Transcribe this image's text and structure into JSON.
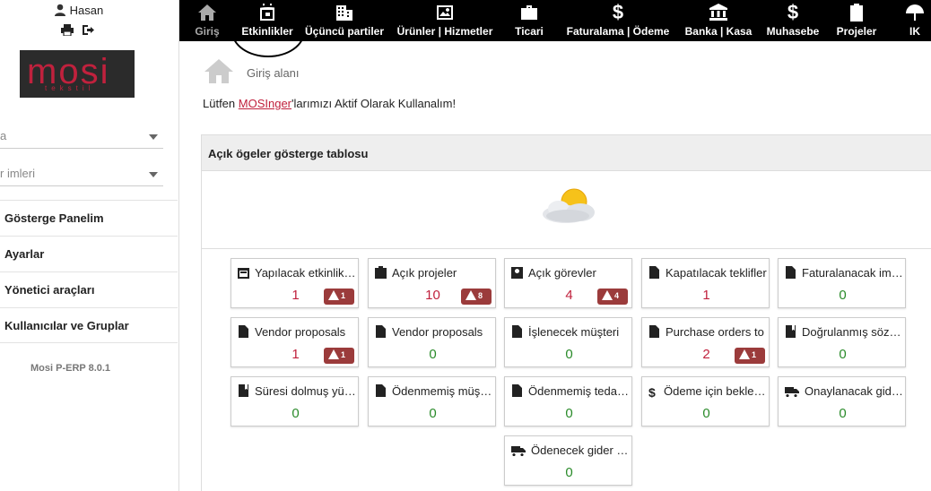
{
  "user": {
    "name": "Hasan"
  },
  "logo": {
    "text": "mosi",
    "sub": "tekstil"
  },
  "selects": [
    {
      "value": "a"
    },
    {
      "value": "r imleri"
    }
  ],
  "menu": [
    "Gösterge Panelim",
    "Ayarlar",
    "Yönetici araçları",
    "Kullanıcılar ve Gruplar"
  ],
  "version": "Mosi P-ERP 8.0.1",
  "topnav": [
    {
      "label": "Giriş",
      "icon": "home-icon"
    },
    {
      "label": "Etkinlikler",
      "icon": "calendar-icon"
    },
    {
      "label": "Üçüncü partiler",
      "icon": "building-icon"
    },
    {
      "label": "Ürünler | Hizmetler",
      "icon": "image-icon"
    },
    {
      "label": "Ticari",
      "icon": "briefcase-icon"
    },
    {
      "label": "Faturalama | Ödeme",
      "icon": "dollar-icon"
    },
    {
      "label": "Banka | Kasa",
      "icon": "bank-icon"
    },
    {
      "label": "Muhasebe",
      "icon": "dollar-icon"
    },
    {
      "label": "Projeler",
      "icon": "clipboard-icon"
    },
    {
      "label": "IK",
      "icon": "umbrella-icon"
    }
  ],
  "breadcrumb": "Giriş alanı",
  "notice": {
    "before": "Lütfen ",
    "link": "MOSInger",
    "after": "'larımızı Aktif Olarak Kullanalım!"
  },
  "panel": {
    "title": "Açık ögeler gösterge tablosu",
    "boxes": [
      {
        "title": "Yapılacak etkinlikler",
        "value": "1",
        "color": "red",
        "badge": "1",
        "icon": "calendar-icon"
      },
      {
        "title": "Açık projeler",
        "value": "10",
        "color": "red",
        "badge": "8",
        "icon": "project-icon"
      },
      {
        "title": "Açık görevler",
        "value": "4",
        "color": "red",
        "badge": "4",
        "icon": "task-icon"
      },
      {
        "title": "Kapatılacak teklifler",
        "value": "1",
        "color": "red",
        "badge": "",
        "icon": "document-icon"
      },
      {
        "title": "Faturalanacak imalat",
        "value": "0",
        "color": "green",
        "badge": "",
        "icon": "document-icon"
      },
      {
        "title": "Vendor proposals",
        "value": "1",
        "color": "red",
        "badge": "1",
        "icon": "document-icon"
      },
      {
        "title": "Vendor proposals",
        "value": "0",
        "color": "green",
        "badge": "",
        "icon": "document-icon"
      },
      {
        "title": "İşlenecek müşteri",
        "value": "0",
        "color": "green",
        "badge": "",
        "icon": "document-icon"
      },
      {
        "title": "Purchase orders to",
        "value": "2",
        "color": "red",
        "badge": "1",
        "icon": "document-icon"
      },
      {
        "title": "Doğrulanmış sözleşme",
        "value": "0",
        "color": "green",
        "badge": "",
        "icon": "contract-icon"
      },
      {
        "title": "Süresi dolmuş yükümlülük",
        "value": "0",
        "color": "green",
        "badge": "",
        "icon": "contract-icon"
      },
      {
        "title": "Ödenmemiş müşteri",
        "value": "0",
        "color": "green",
        "badge": "",
        "icon": "document-icon"
      },
      {
        "title": "Ödenmemiş tedarikçi",
        "value": "0",
        "color": "green",
        "badge": "",
        "icon": "document-icon"
      },
      {
        "title": "Ödeme için bekleyen",
        "value": "0",
        "color": "green",
        "badge": "",
        "icon": "dollar-icon"
      },
      {
        "title": "Onaylanacak giderler",
        "value": "0",
        "color": "green",
        "badge": "",
        "icon": "truck-icon"
      },
      {
        "title": "Ödenecek gider raporları",
        "value": "0",
        "color": "green",
        "badge": "",
        "icon": "truck-icon"
      }
    ]
  }
}
